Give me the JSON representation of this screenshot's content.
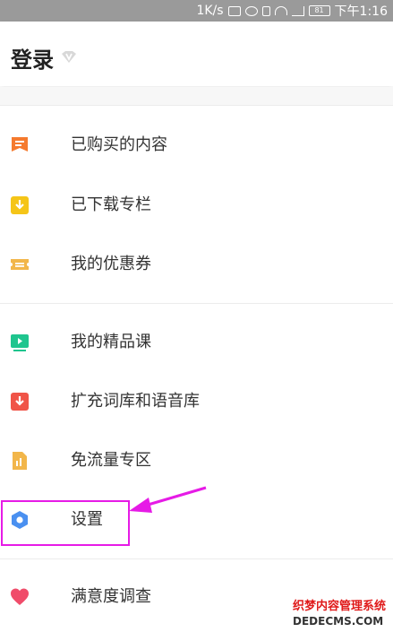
{
  "status_bar": {
    "speed": "1K/s",
    "battery": "81",
    "time": "下午1:16",
    "icons": [
      "mute-icon",
      "alarm-icon",
      "vibrate-icon",
      "wifi-icon",
      "signal-icon",
      "battery-icon"
    ]
  },
  "header": {
    "title": "登录",
    "badge_icon": "v-badge-icon"
  },
  "menu": {
    "group1": [
      {
        "label": "已购买的内容",
        "icon": "purchased-icon",
        "color": "#f57a2e"
      },
      {
        "label": "已下载专栏",
        "icon": "download-icon",
        "color": "#f5c518"
      },
      {
        "label": "我的优惠券",
        "icon": "coupon-icon",
        "color": "#f2b64a"
      }
    ],
    "group2": [
      {
        "label": "我的精品课",
        "icon": "course-play-icon",
        "color": "#1fc58e"
      },
      {
        "label": "扩充词库和语音库",
        "icon": "expand-download-icon",
        "color": "#f05448"
      },
      {
        "label": "免流量专区",
        "icon": "data-free-icon",
        "color": "#f2b64a"
      },
      {
        "label": "设置",
        "icon": "settings-icon",
        "color": "#4a90f0"
      }
    ],
    "group3": [
      {
        "label": "满意度调查",
        "icon": "heart-icon",
        "color": "#f04c6a"
      }
    ]
  },
  "annotation": {
    "highlight_color": "#e61be6"
  },
  "watermark": {
    "line1": "织梦内容管理系统",
    "line2": "DEDECMS.COM"
  }
}
